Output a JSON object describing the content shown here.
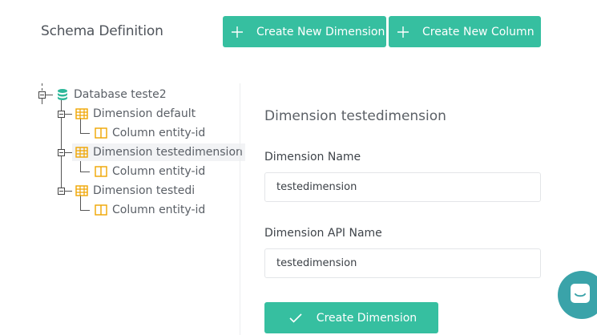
{
  "header": {
    "title": "Schema Definition",
    "create_dimension_label": "Create New Dimension",
    "create_column_label": "Create New Column"
  },
  "tree": {
    "root": {
      "label": "Database teste2",
      "icon": "database-icon"
    },
    "dimensions": [
      {
        "label": "Dimension default",
        "icon": "table-icon",
        "columns": [
          {
            "label": "Column entity-id",
            "icon": "column-icon"
          }
        ]
      },
      {
        "label": "Dimension testedimension",
        "icon": "table-icon",
        "selected": true,
        "columns": [
          {
            "label": "Column entity-id",
            "icon": "column-icon"
          }
        ]
      },
      {
        "label": "Dimension testedi",
        "icon": "table-icon",
        "columns": [
          {
            "label": "Column entity-id",
            "icon": "column-icon"
          }
        ]
      }
    ]
  },
  "form": {
    "title": "Dimension testedimension",
    "name_label": "Dimension Name",
    "name_value": "testedimension",
    "api_label": "Dimension API Name",
    "api_value": "testedimension",
    "submit_label": "Create Dimension"
  },
  "colors": {
    "accent": "#36bfa0",
    "chat": "#3aa3a9",
    "tree_icon": "#f0a500",
    "db_icon": "#2db89a"
  }
}
